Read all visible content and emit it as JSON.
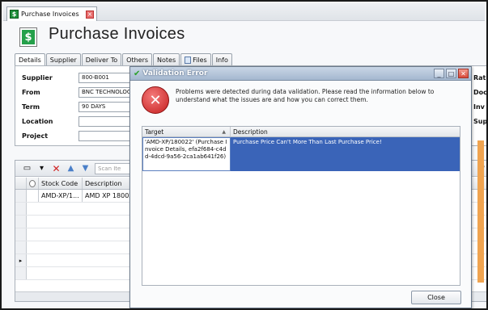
{
  "doc_tab": {
    "label": "Purchase Invoices"
  },
  "page_title": "Purchase Invoices",
  "section_tabs": [
    {
      "label": "Details"
    },
    {
      "label": "Supplier"
    },
    {
      "label": "Deliver To"
    },
    {
      "label": "Others"
    },
    {
      "label": "Notes"
    },
    {
      "label": "Files"
    },
    {
      "label": "Info"
    }
  ],
  "form": {
    "supplier_label": "Supplier",
    "supplier_value": "800-B001",
    "from_label": "From",
    "from_value": "BNC TECHNOLOGY",
    "term_label": "Term",
    "term_value": "90 DAYS",
    "location_label": "Location",
    "location_value": "",
    "project_label": "Project",
    "project_value": "",
    "right_labels": [
      "Rat",
      "Doc",
      "Inv",
      "Sup"
    ]
  },
  "grid": {
    "scan_placeholder": "Scan Ite",
    "columns": [
      "Stock Code",
      "Description"
    ],
    "rows": [
      {
        "stock_code": "AMD-XP/1...",
        "description": "AMD XP 180022"
      }
    ]
  },
  "dialog": {
    "title": "Validation Error",
    "message": "Problems were detected during data validation. Please read the information below to understand what the issues are and how you can correct them.",
    "columns": {
      "target": "Target",
      "description": "Description"
    },
    "error": {
      "target": "'AMD-XP/180022' (Purchase Invoice Details, efa2f684-c4dd-4dcd-9a56-2ca1ab641f26)",
      "description": "Purchase Price Can't More Than Last Purchase Price!"
    },
    "close_label": "Close"
  },
  "colors": {
    "accent": "#3a64b8",
    "error": "#c51e1e",
    "brand_green": "#24a04a",
    "side_orange": "#f0a450"
  }
}
